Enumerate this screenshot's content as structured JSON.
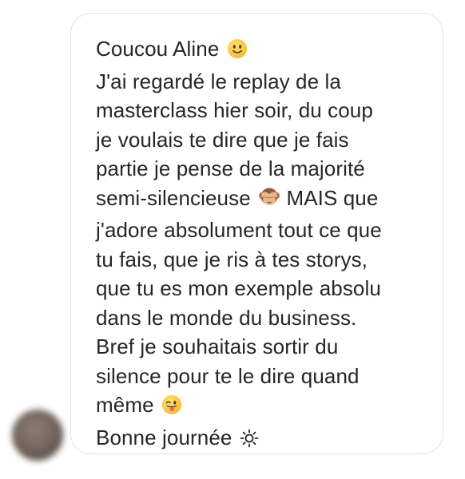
{
  "message": {
    "lines": [
      "Coucou Aline",
      "J'ai regardé le replay de la",
      "masterclass hier soir, du coup",
      "je voulais te dire que je fais",
      "partie je pense de la majorité",
      "semi-silencieuse",
      "MAIS que",
      "j'adore absolument tout ce que",
      "tu fais, que je ris à tes storys,",
      "que tu es mon exemple absolu",
      "dans le monde du business.",
      "Bref je souhaitais sortir du",
      "silence pour te le dire quand",
      "même",
      "Bonne journée"
    ],
    "emojis": [
      "slightly-smiling-face-emoji",
      "see-no-evil-monkey-emoji",
      "face-with-tongue-emoji",
      "sun-emoji"
    ]
  }
}
